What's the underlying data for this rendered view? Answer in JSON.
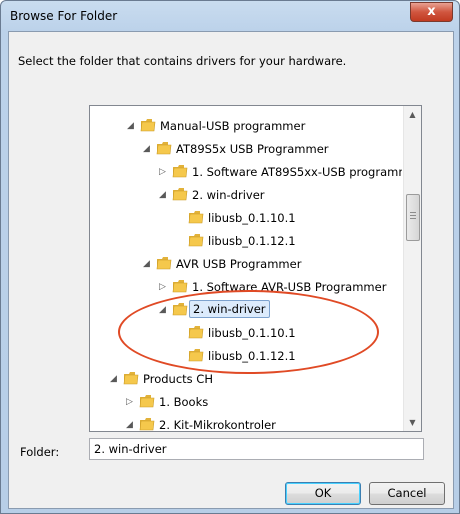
{
  "window": {
    "title": "Browse For Folder",
    "close_glyph": "x"
  },
  "instruction": "Select the folder that contains drivers for your hardware.",
  "tree": {
    "items": [
      {
        "label": "Manual-USB programmer",
        "expander": "expanded"
      },
      {
        "label": "AT89S5x USB Programmer",
        "expander": "expanded"
      },
      {
        "label": "1. Software AT89S5xx-USB programmer",
        "expander": "collapsed"
      },
      {
        "label": "2. win-driver",
        "expander": "expanded"
      },
      {
        "label": "libusb_0.1.10.1",
        "expander": "none"
      },
      {
        "label": "libusb_0.1.12.1",
        "expander": "none"
      },
      {
        "label": "AVR USB Programmer",
        "expander": "expanded"
      },
      {
        "label": "1. Software AVR-USB Programmer",
        "expander": "collapsed"
      },
      {
        "label": "2. win-driver",
        "expander": "expanded",
        "selected": true
      },
      {
        "label": "libusb_0.1.10.1",
        "expander": "none"
      },
      {
        "label": "libusb_0.1.12.1",
        "expander": "none"
      },
      {
        "label": "Products CH",
        "expander": "expanded"
      },
      {
        "label": "1. Books",
        "expander": "collapsed"
      },
      {
        "label": "2. Kit-Mikrokontroler",
        "expander": "expanded"
      }
    ]
  },
  "folder": {
    "label": "Folder:",
    "value": "2. win-driver"
  },
  "buttons": {
    "ok": "OK",
    "cancel": "Cancel"
  },
  "icons": {
    "expanded": "triangle-down-right-icon",
    "collapsed": "triangle-right-icon",
    "folder": "folder-icon"
  },
  "colors": {
    "annotation": "#e04a25",
    "selection": "#dcebfc",
    "folder": "#f5c84c"
  }
}
